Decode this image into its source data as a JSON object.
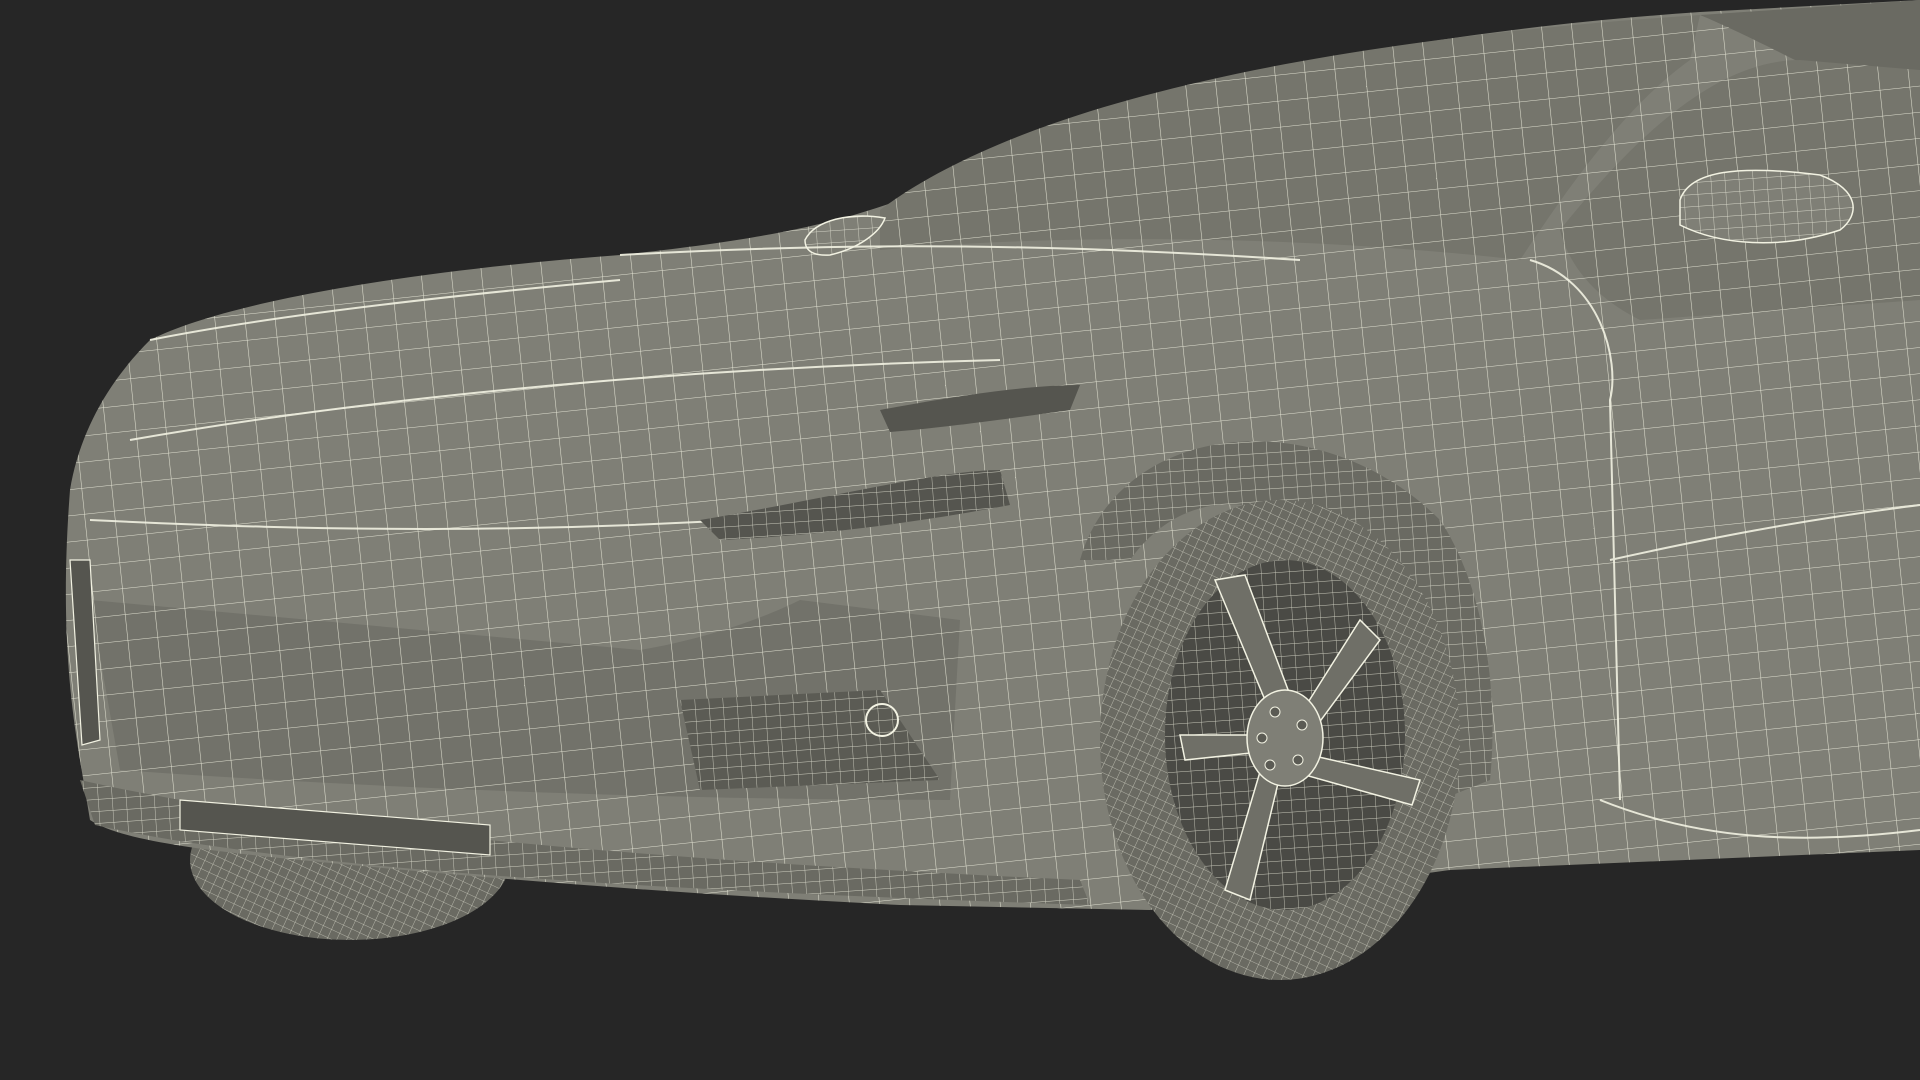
{
  "scene": {
    "background_color": "#262626",
    "body_color": "#7f7f76",
    "body_shade_color": "#6a6a62",
    "dark_color": "#3e3e3a",
    "wire_color": "#f2f2e2",
    "subject": "car-wireframe-render"
  }
}
